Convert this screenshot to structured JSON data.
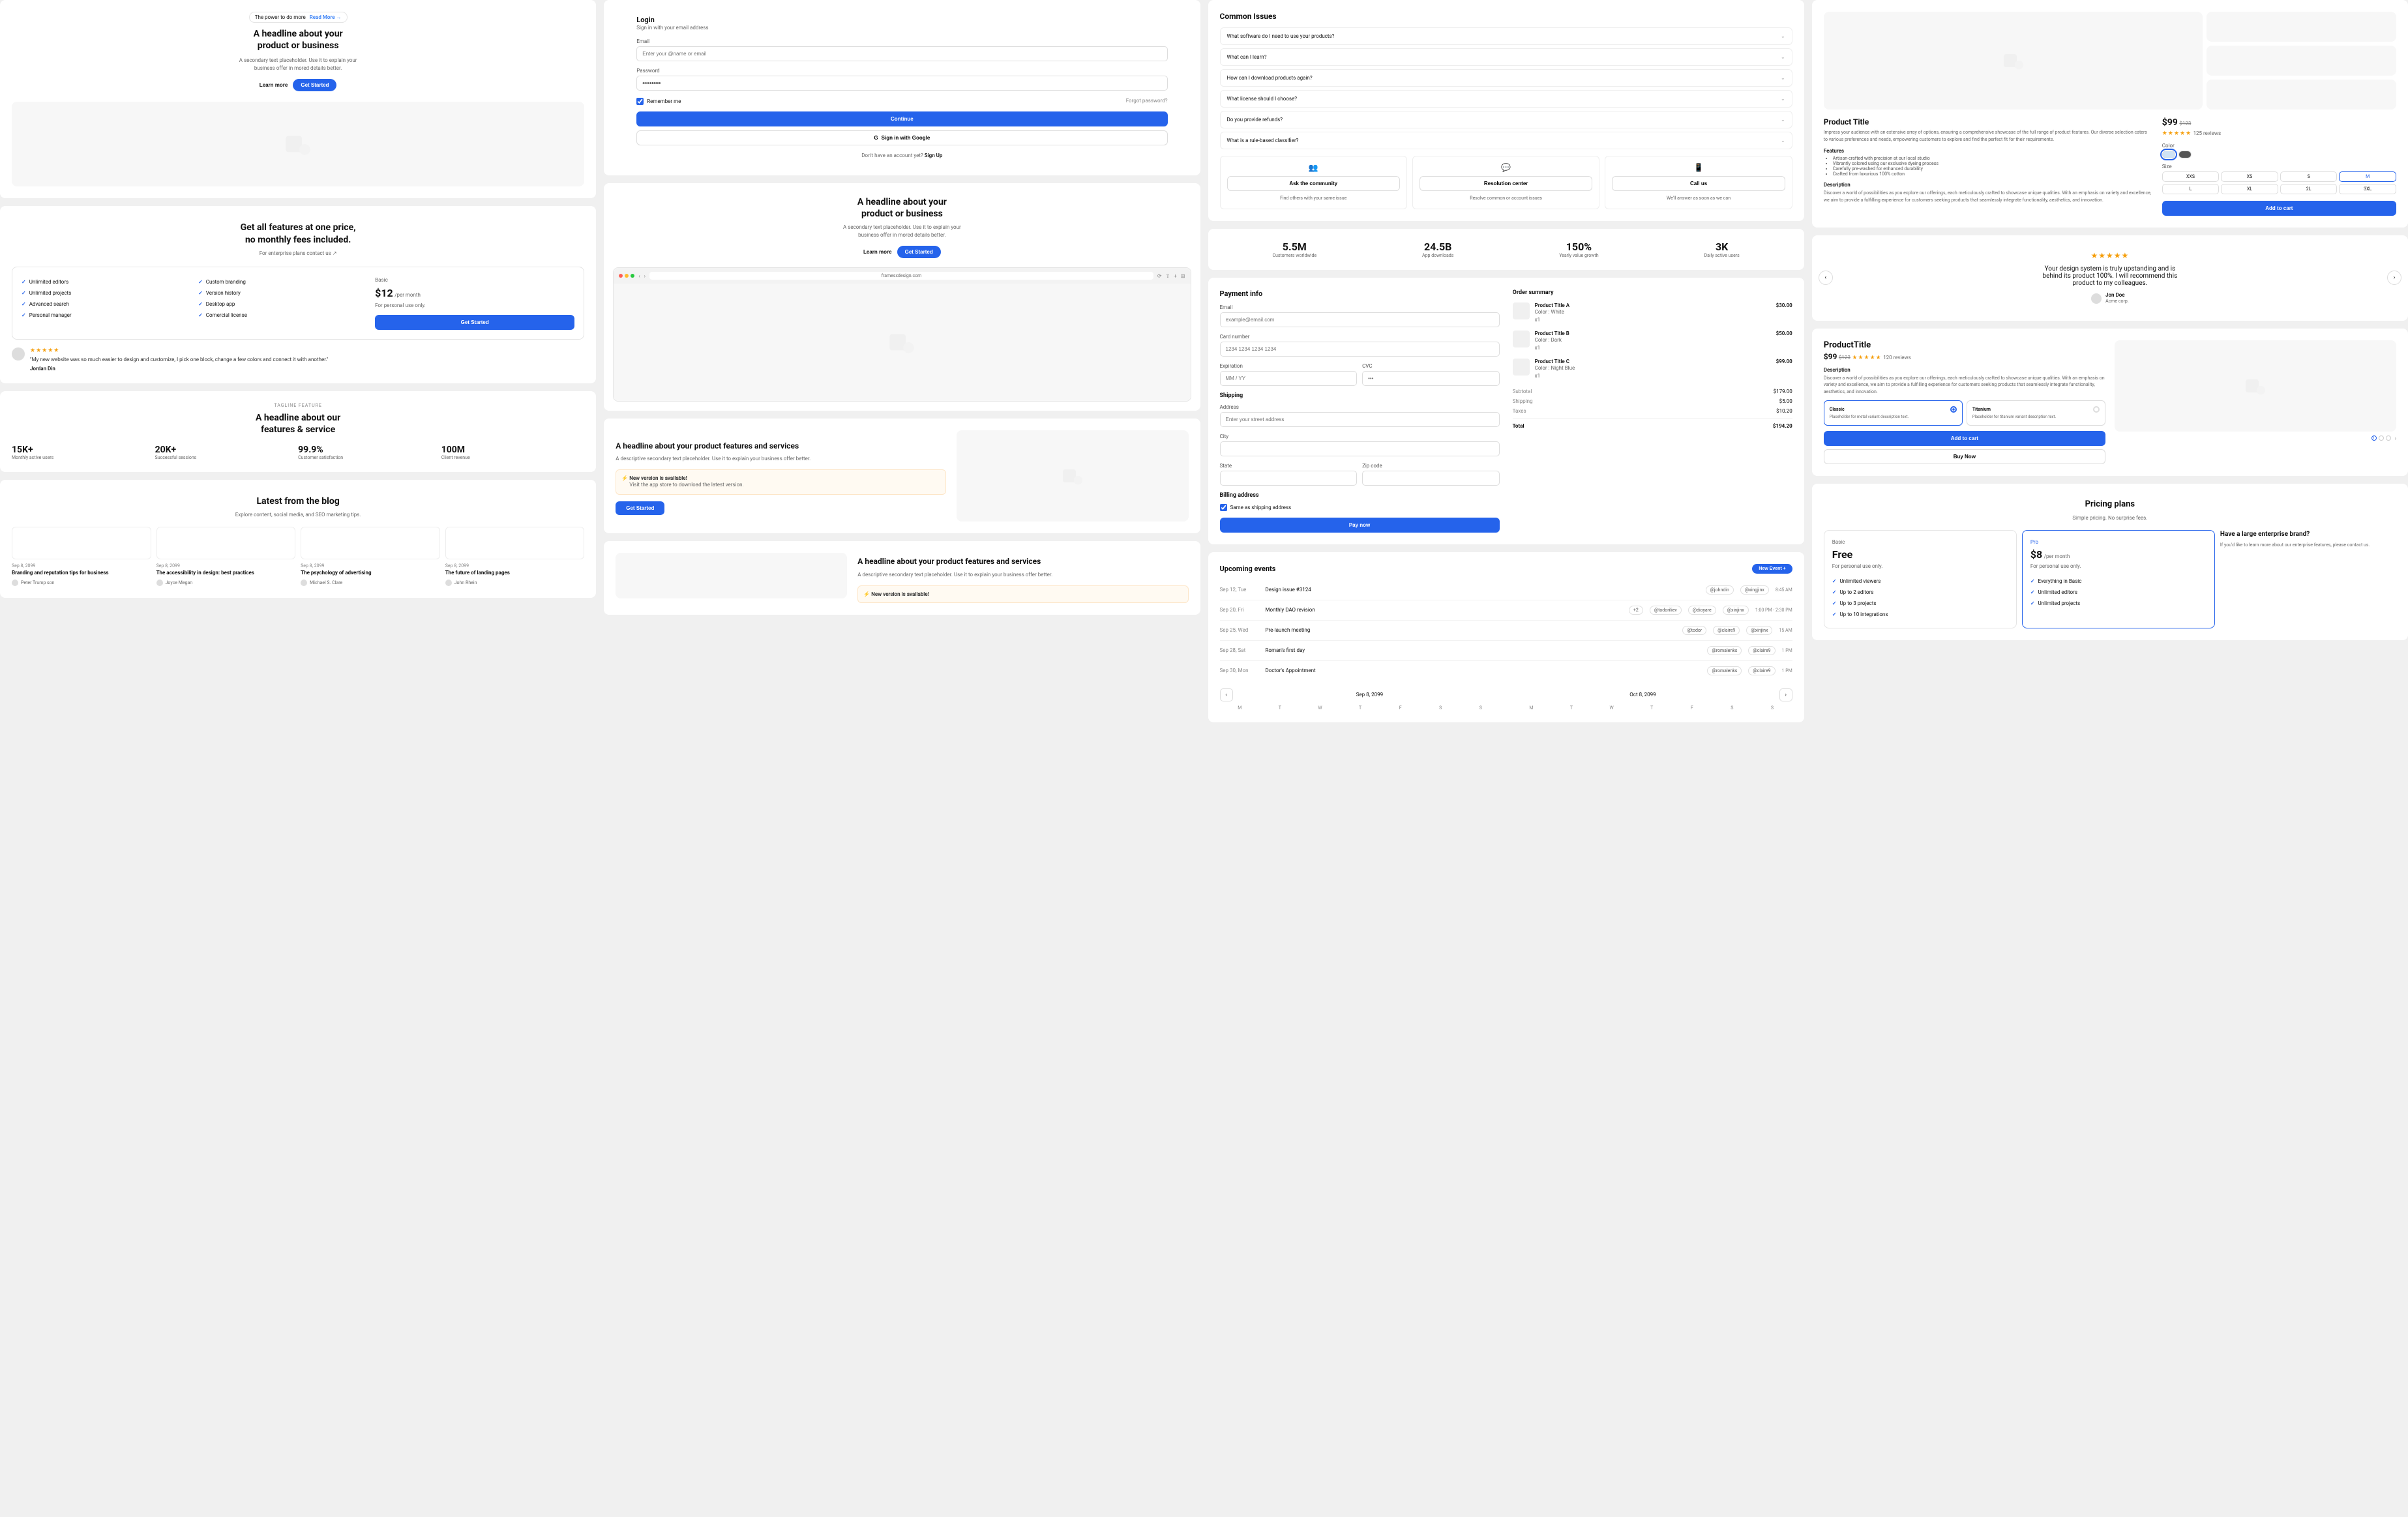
{
  "hero1": {
    "tagline": "The power to do more",
    "readmore": "Read More →",
    "headline": "A headline about your product or business",
    "sub": "A secondary text placeholder. Use it to explain your business offer in mored details better.",
    "learn": "Learn more",
    "cta": "Get Started"
  },
  "pricing1": {
    "title1": "Get all features at one price,",
    "title2": "no monthly fees included.",
    "enterprise": "For enterprise plans contact us ↗",
    "features_left": [
      "Unlimited editors",
      "Unlimited projects",
      "Advanced search",
      "Personal manager"
    ],
    "features_right": [
      "Custom branding",
      "Version history",
      "Desktop app",
      "Comercial license"
    ],
    "plan_name": "Basic",
    "price": "$12",
    "per": "/per month",
    "note": "For personal use only.",
    "cta": "Get Started",
    "review_text": "\"My new website was so much easier to design and customize, I pick one block, change a few colors and connect it with another.\"",
    "review_author": "Jordan Din"
  },
  "features1": {
    "tagline": "TAGLINE FEATURE",
    "title1": "A headline about our",
    "title2": "features & service",
    "stats": [
      {
        "n": "15K+",
        "l": "Monthly active users"
      },
      {
        "n": "20K+",
        "l": "Successful sessions"
      },
      {
        "n": "99.9%",
        "l": "Customer satisfaction"
      },
      {
        "n": "100M",
        "l": "Client revenue"
      }
    ]
  },
  "blog": {
    "title": "Latest from the blog",
    "sub": "Explore content, social media, and SEO marketing tips.",
    "posts": [
      {
        "date": "Sep 8, 2099",
        "title": "Branding and reputation tips for business",
        "author": "Peter Trump son"
      },
      {
        "date": "Sep 8, 2099",
        "title": "The accessibility in design: best practices",
        "author": "Joyce Megan"
      },
      {
        "date": "Sep 8, 2099",
        "title": "The psychology of advertising",
        "author": "Michael S. Clare"
      },
      {
        "date": "Sep 8, 2099",
        "title": "The future of landing pages",
        "author": "John Rhein"
      }
    ]
  },
  "login": {
    "title": "Login",
    "sub": "Sign in with your email address",
    "email_label": "Email",
    "email_ph": "Enter your @name or email",
    "pass_label": "Password",
    "pass_val": "••••••••••",
    "remember": "Remember me",
    "forgot": "Forgot password?",
    "continue": "Continue",
    "google": "Sign in with Google",
    "signup_q": "Don't have an account yet?",
    "signup": "Sign Up"
  },
  "hero2": {
    "headline": "A headline about your product or business",
    "sub": "A secondary text placeholder. Use it to explain your business offer in mored details better.",
    "learn": "Learn more",
    "cta": "Get Started",
    "url": "framesxdesign.com"
  },
  "feature2": {
    "title": "A headline about your product features and services",
    "sub": "A descriptive secondary text placeholder. Use it to explain your business offer better.",
    "alert_title": "New version is available!",
    "alert_sub": "Visit the app store to download the latest version.",
    "cta": "Get Started"
  },
  "feature3": {
    "title": "A headline about your product features and services",
    "sub": "A descriptive secondary text placeholder. Use it to explain your business offer better.",
    "alert_title": "New version is available!"
  },
  "faq": {
    "title": "Common Issues",
    "items": [
      "What software do I need to use your products?",
      "What can I learn?",
      "How can I download products again?",
      "What license should I choose?",
      "Do you provide refunds?",
      "What is a rule-based classifier?"
    ],
    "help": [
      {
        "icon": "👥",
        "title": "Ask the community",
        "sub": "Find others with your same issue"
      },
      {
        "icon": "💬",
        "title": "Resolution center",
        "sub": "Resolve common or account issues"
      },
      {
        "icon": "📱",
        "title": "Call us",
        "sub": "We'll answer as soon as we can"
      }
    ]
  },
  "metrics": [
    {
      "n": "5.5M",
      "l": "Customers worldwide"
    },
    {
      "n": "24.5B",
      "l": "App downloads"
    },
    {
      "n": "150%",
      "l": "Yearly value growth"
    },
    {
      "n": "3K",
      "l": "Daily active users"
    }
  ],
  "checkout": {
    "title": "Payment info",
    "email_label": "Email",
    "email_ph": "example@email.com",
    "card_label": "Card number",
    "card_ph": "1234 1234 1234 1234",
    "exp_label": "Expiration",
    "exp_ph": "MM / YY",
    "cvc_label": "CVC",
    "cvc_ph": "•••",
    "ship_title": "Shipping",
    "addr_label": "Address",
    "addr_ph": "Enter your street address",
    "city_label": "City",
    "state_label": "State",
    "zip_label": "Zip code",
    "billing_title": "Billing address",
    "same": "Same as shipping address",
    "pay": "Pay now",
    "summary_title": "Order summary",
    "items": [
      {
        "name": "Product Title A",
        "color": "Color : White",
        "qty": "x1",
        "price": "$30.00"
      },
      {
        "name": "Product Title B",
        "color": "Color : Dark",
        "qty": "x1",
        "price": "$50.00"
      },
      {
        "name": "Product Title C",
        "color": "Color : Night Blue",
        "qty": "x1",
        "price": "$99.00"
      }
    ],
    "subtotal_l": "Subtotal",
    "subtotal": "$179.00",
    "shipping_l": "Shipping",
    "shipping": "$5.00",
    "taxes_l": "Taxes",
    "taxes": "$10.20",
    "total_l": "Total",
    "total": "$194.20"
  },
  "events": {
    "title": "Upcoming events",
    "new": "New Event +",
    "rows": [
      {
        "date": "Sep 12, Tue",
        "title": "Design issue #3124",
        "tags": [
          "@johndin",
          "@xingjinx"
        ],
        "time": "8:45 AM"
      },
      {
        "date": "Sep 20, Fri",
        "title": "Monthly DAO revision",
        "extra": "+2",
        "tags": [
          "@todoriliev",
          "@dioyare",
          "@xinjinx"
        ],
        "time": "1:00 PM - 2:30 PM"
      },
      {
        "date": "Sep 25, Wed",
        "title": "Pre-launch meeting",
        "tags": [
          "@todor",
          "@claire9",
          "@xinjinx"
        ],
        "time": "15 AM"
      },
      {
        "date": "Sep 28, Sat",
        "title": "Roman's first day",
        "tags": [
          "@romalenks",
          "@claire9"
        ],
        "time": "1 PM"
      },
      {
        "date": "Sep 30, Mon",
        "title": "Doctor's Appointment",
        "tags": [
          "@romalenks",
          "@claire9"
        ],
        "time": "1 PM"
      }
    ],
    "month1": "Sep 8, 2099",
    "month2": "Oct 8, 2099",
    "days": [
      "M",
      "T",
      "W",
      "T",
      "F",
      "S",
      "S"
    ]
  },
  "product1": {
    "title": "Product Title",
    "price": "$99",
    "old": "$123",
    "reviews": "125 reviews",
    "desc_short": "Impress your audience with an extensive array of options, ensuring a comprehensive showcase of the full range of product features. Our diverse selection caters to various preferences and needs, empowering customers to explore and find the perfect fit for their requirements.",
    "color_label": "Color",
    "features_label": "Features",
    "features": [
      "Artisan-crafted with precision at our local studio",
      "Vibrantly colored using our exclusive dyeing process",
      "Carefully pre-washed for enhanced durability",
      "Crafted from luxurious 100% cotton"
    ],
    "size_label": "Size",
    "sizes": [
      "XXS",
      "XS",
      "S",
      "M",
      "L",
      "XL",
      "2L",
      "3XL"
    ],
    "desc_label": "Description",
    "desc_long": "Discover a world of possibilities as you explore our offerings, each meticulously crafted to showcase unique qualities. With an emphasis on variety and excellence, we aim to provide a fulfilling experience for customers seeking products that seamlessly integrate functionality, aesthetics, and innovation.",
    "cta": "Add to cart"
  },
  "testimonial": {
    "text": "Your design system is truly upstanding and is behind its product 100%. I will recommend this product to my colleagues.",
    "name": "Jon Doe",
    "org": "Acme corp."
  },
  "product2": {
    "title": "ProductTitle",
    "price": "$99",
    "old": "$123",
    "reviews": "120 reviews",
    "desc_label": "Description",
    "desc": "Discover a world of possibilities as you explore our offerings, each meticulously crafted to showcase unique qualities. With an emphasis on variety and excellence, we aim to provide a fulfilling experience for customers seeking products that seamlessly integrate functionality, aesthetics, and innovation.",
    "v1_name": "Classic",
    "v1_sub": "Placeholder for metal variant description text.",
    "v2_name": "Titanium",
    "v2_sub": "Placeholder for titanium variant description text.",
    "add": "Add to cart",
    "buy": "Buy Now"
  },
  "plans": {
    "title": "Pricing plans",
    "sub": "Simple pricing. No surprise fees.",
    "basic": {
      "name": "Basic",
      "price": "Free",
      "note": "For personal use only.",
      "feats": [
        "Unlimited viewers",
        "Up to 2 editors",
        "Up to 3 projects",
        "Up to 10 integrations"
      ]
    },
    "pro": {
      "name": "Pro",
      "price": "$8",
      "per": "/per month",
      "note": "For personal use only.",
      "feats": [
        "Everything in Basic",
        "Unlimited editors",
        "Unlimited projects"
      ]
    },
    "ent_title": "Have a large enterprise brand?",
    "ent_sub": "If you'd like to learn more about our enterprise features, please contact us."
  }
}
